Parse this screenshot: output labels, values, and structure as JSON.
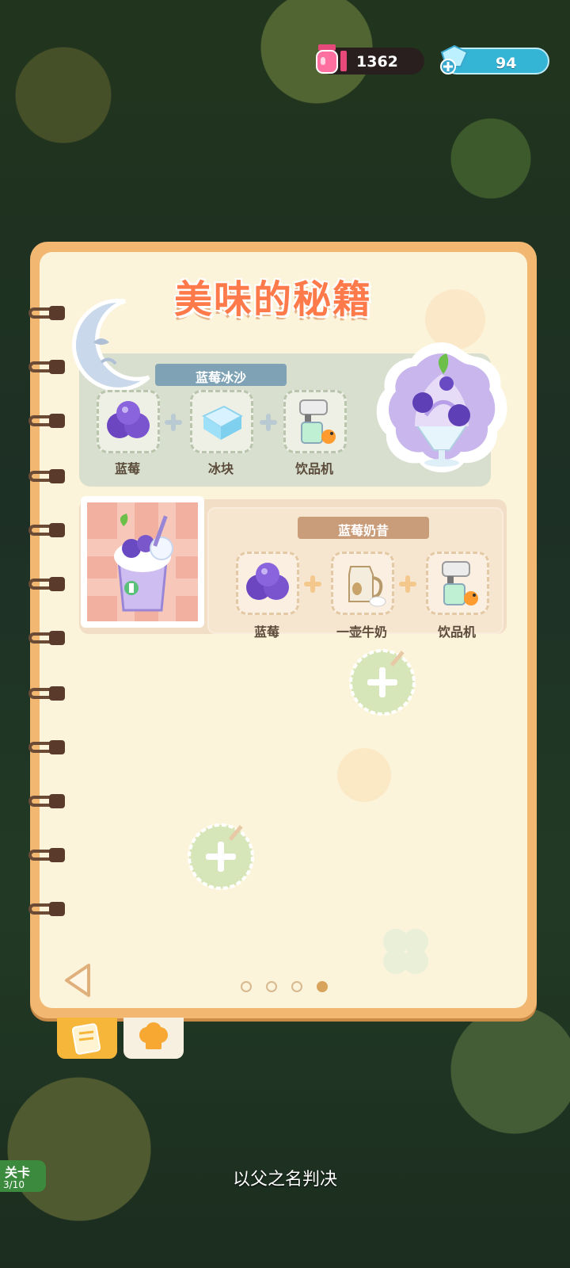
{
  "hud": {
    "jam_value": "1362",
    "gem_value": "94",
    "jar_icon": "jam-jar-icon",
    "gem_icon": "diamond-plus-icon"
  },
  "recipe_book": {
    "title": "美味的秘籍",
    "recipes": [
      {
        "name": "蓝莓冰沙",
        "ingredients": [
          "蓝莓",
          "冰块",
          "饮品机"
        ],
        "result_icon": "blueberry-smoothie-icon"
      },
      {
        "name": "蓝莓奶昔",
        "ingredients": [
          "蓝莓",
          "一壶牛奶",
          "饮品机"
        ],
        "result_icon": "blueberry-milkshake-icon"
      }
    ],
    "pagination": {
      "total": 4,
      "current": 4
    }
  },
  "tabs": [
    "recipe-book-tab-icon",
    "chef-hat-tab-icon"
  ],
  "stage": {
    "label": "关卡",
    "count": "3/10"
  },
  "caption": "以父之名判决",
  "colors": {
    "book_frame": "#f2b872",
    "page": "#fbf4da",
    "accent_orange": "#ff7a4a"
  }
}
